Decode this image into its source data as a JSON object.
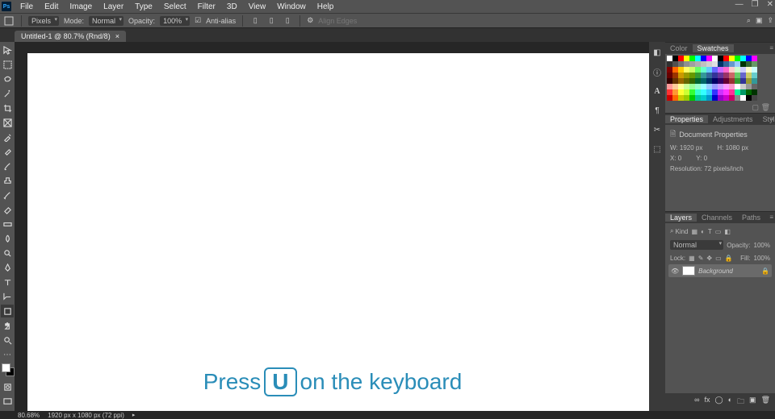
{
  "menu": [
    "File",
    "Edit",
    "Image",
    "Layer",
    "Type",
    "Select",
    "Filter",
    "3D",
    "View",
    "Window",
    "Help"
  ],
  "options": {
    "units": "Pixels",
    "mode_label": "Mode:",
    "mode": "Normal",
    "opacity_label": "Opacity:",
    "opacity": "100%",
    "antialias": "Anti-alias",
    "align": "Align Edges"
  },
  "tab": {
    "name": "Untitled-1 @ 80.7% (Rnd/8)",
    "close": "×"
  },
  "swatches_panel": {
    "tabs": [
      "Color",
      "Swatches"
    ],
    "active": 1
  },
  "swatch_colors": [
    "#ffffff",
    "#000000",
    "#ff0000",
    "#ffff00",
    "#00ff00",
    "#00ffff",
    "#0000ff",
    "#ff00ff",
    "#ffffff",
    "#000000",
    "#ff0000",
    "#ffff00",
    "#00ff00",
    "#00ffff",
    "#0000ff",
    "#ff00ff",
    "#303030",
    "#505050",
    "#707070",
    "#909090",
    "#a0a0a0",
    "#b0b0b0",
    "#c0c0c0",
    "#d0d0d0",
    "#e0e0e0",
    "#003366",
    "#336699",
    "#6699cc",
    "#99ccff",
    "#003300",
    "#336633",
    "#669966",
    "#800000",
    "#ff6600",
    "#ffcc00",
    "#ffff66",
    "#ccff66",
    "#66ff66",
    "#66ffcc",
    "#66ccff",
    "#6666ff",
    "#cc66ff",
    "#ff66cc",
    "#ffcccc",
    "#ccffcc",
    "#ccccff",
    "#ffffcc",
    "#ccffff",
    "#660000",
    "#993300",
    "#cc9900",
    "#999900",
    "#669900",
    "#339933",
    "#339999",
    "#336699",
    "#333399",
    "#663399",
    "#993366",
    "#cc6666",
    "#66cc66",
    "#6666cc",
    "#cccc66",
    "#66cccc",
    "#330000",
    "#663300",
    "#996600",
    "#666600",
    "#336600",
    "#006633",
    "#006666",
    "#003366",
    "#000066",
    "#330066",
    "#660033",
    "#993333",
    "#339933",
    "#333399",
    "#999933",
    "#339999",
    "#ff9999",
    "#ffcc99",
    "#ffff99",
    "#ccff99",
    "#99ff99",
    "#99ffcc",
    "#99ffff",
    "#99ccff",
    "#9999ff",
    "#cc99ff",
    "#ff99ff",
    "#ff99cc",
    "#ffffff",
    "#cccccc",
    "#999999",
    "#666666",
    "#ff3333",
    "#ff9933",
    "#ffff33",
    "#ccff33",
    "#33ff33",
    "#33ffcc",
    "#33ffff",
    "#33ccff",
    "#3333ff",
    "#cc33ff",
    "#ff33ff",
    "#ff3399",
    "#00ff99",
    "#009966",
    "#006600",
    "#003300",
    "#cc0000",
    "#ff6600",
    "#cccc00",
    "#99cc00",
    "#00cc00",
    "#00cc99",
    "#00cccc",
    "#0099cc",
    "#0000cc",
    "#9900cc",
    "#cc00cc",
    "#cc0066",
    "#888888",
    "#ffffff",
    "#000000",
    "#444444"
  ],
  "properties": {
    "tabs": [
      "Properties",
      "Adjustments",
      "Styles"
    ],
    "title": "Document Properties",
    "w_label": "W:",
    "w": "1920 px",
    "h_label": "H:",
    "h": "1080 px",
    "x_label": "X:",
    "x": "0",
    "y_label": "Y:",
    "y": "0",
    "res": "Resolution: 72 pixels/inch"
  },
  "layers": {
    "tabs": [
      "Layers",
      "Channels",
      "Paths"
    ],
    "kind": "Kind",
    "blend": "Normal",
    "opacity_label": "Opacity:",
    "opacity": "100%",
    "lock": "Lock:",
    "fill_label": "Fill:",
    "fill": "100%",
    "layer_name": "Background"
  },
  "status": {
    "zoom": "80.68%",
    "docinfo": "1920 px x 1080 px (72 ppi)"
  },
  "instruction": {
    "pre": "Press",
    "key": "U",
    "post": "on the keyboard"
  }
}
